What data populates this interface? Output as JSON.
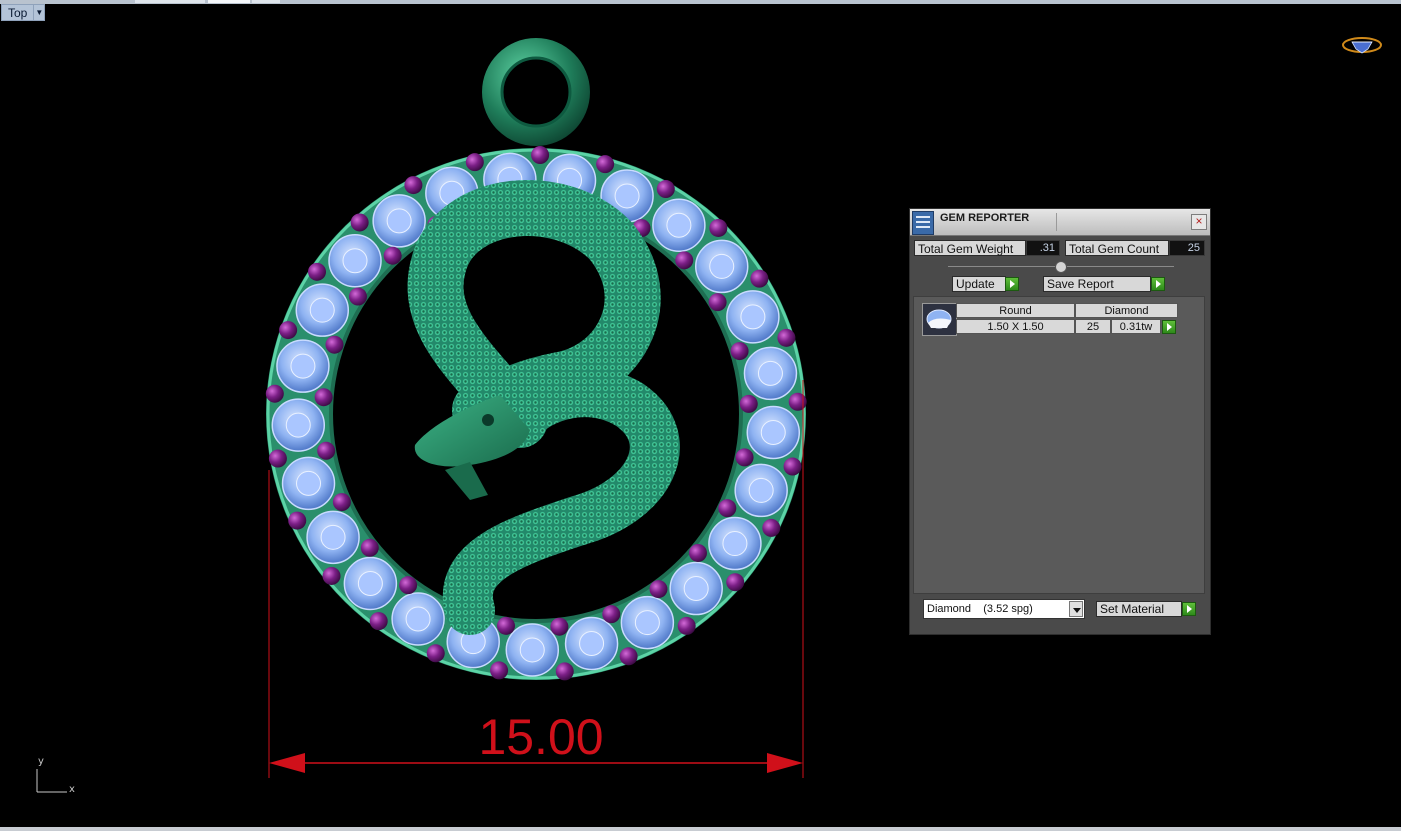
{
  "viewport": {
    "name": "Top"
  },
  "axis": {
    "y": "y",
    "x": "x"
  },
  "dimension": {
    "value": "15.00"
  },
  "gem_reporter": {
    "title": "GEM REPORTER",
    "total_gem_weight_label": "Total Gem Weight",
    "total_gem_weight": ".31",
    "total_gem_count_label": "Total Gem Count",
    "total_gem_count": "25",
    "update_label": "Update",
    "save_report_label": "Save Report",
    "rows": [
      {
        "shape": "Round",
        "material": "Diamond",
        "size": "1.50 X 1.50",
        "count": "25",
        "weight": "0.31tw"
      }
    ],
    "material_select": "Diamond    (3.52 spg)",
    "set_material_label": "Set Material"
  },
  "colors": {
    "accent_dimension": "#d0101a",
    "metal": "#2a8f6c",
    "gem": "#8fb3f2",
    "bead": "#7b1f86"
  }
}
